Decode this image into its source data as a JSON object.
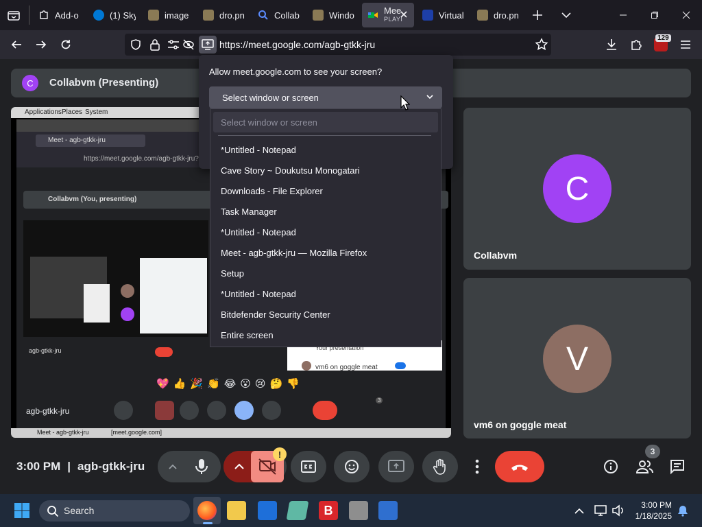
{
  "browser": {
    "tabs": [
      {
        "title": "Add-o",
        "icon": "puzzle-icon"
      },
      {
        "title": "(1) Sky",
        "icon": "skype-icon"
      },
      {
        "title": "image",
        "icon": "image-icon"
      },
      {
        "title": "dro.pn",
        "icon": "image-icon"
      },
      {
        "title": "Collab",
        "icon": "search-icon"
      },
      {
        "title": "Windo",
        "icon": "image-icon"
      },
      {
        "title": "Mee",
        "sub": "PLAYI",
        "icon": "meet-icon",
        "active": true
      },
      {
        "title": "Virtual",
        "icon": "vm-icon"
      },
      {
        "title": "dro.pn",
        "icon": "image-icon"
      }
    ],
    "url": "https://meet.google.com/agb-gtkk-jru",
    "badge_count": "129"
  },
  "permission": {
    "question": "Allow meet.google.com to see your screen?",
    "select_label": "Select window or screen",
    "filter_placeholder": "Select window or screen",
    "options": [
      "*Untitled - Notepad",
      "Cave Story ~ Doukutsu Monogatari",
      "Downloads - File Explorer",
      "Task Manager",
      "*Untitled - Notepad",
      "Meet - agb-gtkk-jru — Mozilla Firefox",
      "Setup",
      "*Untitled - Notepad",
      "Bitdefender Security Center",
      "Entire screen"
    ]
  },
  "meet": {
    "presenter_initial": "C",
    "presenter_title": "Collabvm (Presenting)",
    "shared": {
      "menu": [
        "Applications",
        "Places",
        "System"
      ],
      "inner_tab": "Meet - agb-gtkk-jru",
      "inner_url": "https://meet.google.com/agb-gtkk-jru?pli",
      "inner_presenting": "Collabvm (You, presenting)",
      "inner_meeting": "agb-gtkk-jru",
      "reactions": [
        "💖",
        "👍",
        "🎉",
        "👏",
        "😂",
        "😮",
        "😢",
        "🤔",
        "👎"
      ],
      "task_meet": "Meet - agb-gtkk-jru",
      "task_meet2": "[meet.google.com]",
      "your_presentation": "Your presentation",
      "participant_vm6": "vm6 on goggle meat",
      "participant_count": "3"
    },
    "tiles": [
      {
        "initial": "C",
        "name": "Collabvm",
        "color": "#a142f4"
      },
      {
        "initial": "V",
        "name": "vm6 on goggle meat",
        "color": "#8d6e63"
      }
    ],
    "time": "3:00 PM",
    "divider": "|",
    "meeting_code": "agb-gtkk-jru",
    "people_count": "3",
    "warning": "!"
  },
  "taskbar": {
    "search_label": "Search",
    "clock_time": "3:00 PM",
    "clock_date": "1/18/2025"
  }
}
